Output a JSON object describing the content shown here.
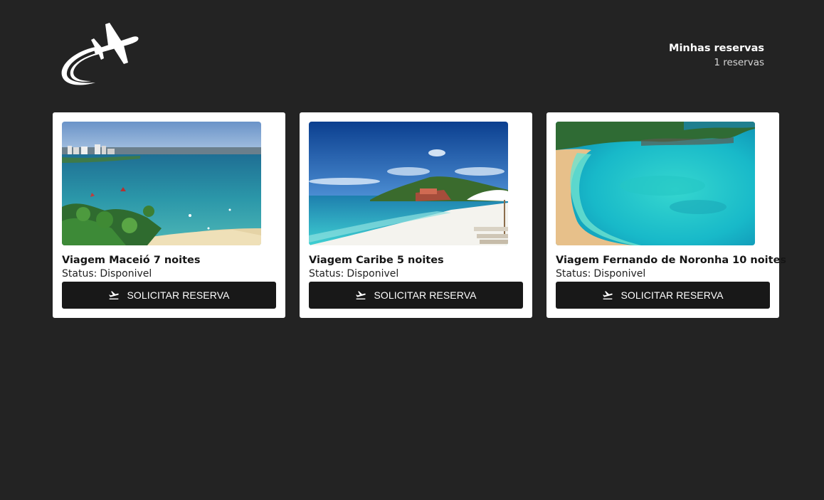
{
  "header": {
    "logo_icon": "airplane-logo-icon",
    "reservas_title": "Minhas reservas",
    "reservas_count": "1 reservas"
  },
  "trips": [
    {
      "title": "Viagem Maceió 7 noites",
      "status_label": "Status:",
      "status_value": "Disponivel",
      "button_label": "SOLICITAR RESERVA",
      "button_icon": "flight-takeoff-icon"
    },
    {
      "title": "Viagem Caribe 5 noites",
      "status_label": "Status:",
      "status_value": "Disponivel",
      "button_label": "SOLICITAR RESERVA",
      "button_icon": "flight-takeoff-icon"
    },
    {
      "title": "Viagem Fernando de Noronha 10 noites",
      "status_label": "Status:",
      "status_value": "Disponivel",
      "button_label": "SOLICITAR RESERVA",
      "button_icon": "flight-takeoff-icon"
    }
  ],
  "colors": {
    "background": "#232323",
    "card": "#ffffff",
    "button": "#181818",
    "text": "#161616"
  }
}
